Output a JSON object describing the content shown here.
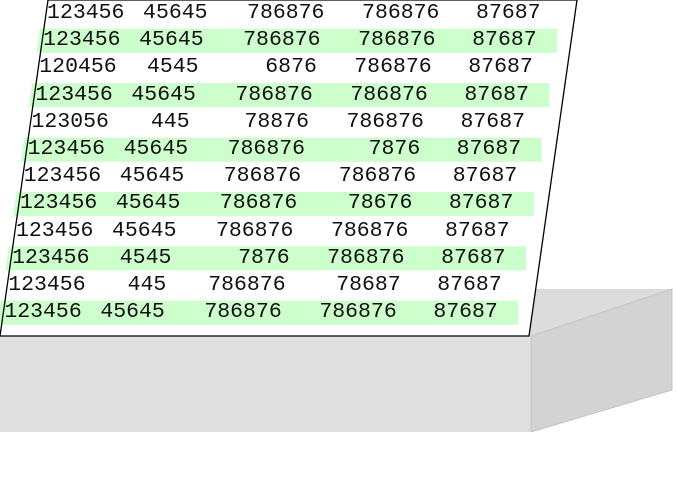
{
  "colors": {
    "stripe": "#ccffcc",
    "text": "#111111",
    "outline": "#000000",
    "box_top": "#dcdcdc",
    "box_front": "#e0e0e0",
    "box_side": "#d3d3d3"
  },
  "sheet": {
    "rows": [
      {
        "striped": false,
        "cells": [
          "123456",
          "45645",
          "786876",
          "786876",
          "87687"
        ]
      },
      {
        "striped": true,
        "cells": [
          "123456",
          "45645",
          "786876",
          "786876",
          "87687"
        ]
      },
      {
        "striped": false,
        "cells": [
          "120456",
          "4545",
          "6876",
          "786876",
          "87687"
        ]
      },
      {
        "striped": true,
        "cells": [
          "123456",
          "45645",
          "786876",
          "786876",
          "87687"
        ]
      },
      {
        "striped": false,
        "cells": [
          "123056",
          "445",
          "78876",
          "786876",
          "87687"
        ]
      },
      {
        "striped": true,
        "cells": [
          "123456",
          "45645",
          "786876",
          "7876",
          "87687"
        ]
      },
      {
        "striped": false,
        "cells": [
          "123456",
          "45645",
          "786876",
          "786876",
          "87687"
        ]
      },
      {
        "striped": true,
        "cells": [
          "123456",
          "45645",
          "786876",
          "78676",
          "87687"
        ]
      },
      {
        "striped": false,
        "cells": [
          "123456",
          "45645",
          "786876",
          "786876",
          "87687"
        ]
      },
      {
        "striped": true,
        "cells": [
          "123456",
          "4545",
          "7876",
          "786876",
          "87687"
        ]
      },
      {
        "striped": false,
        "cells": [
          "123456",
          "445",
          "786876",
          "78687",
          "87687"
        ]
      },
      {
        "striped": true,
        "cells": [
          "123456",
          "45645",
          "786876",
          "786876",
          "87687"
        ]
      }
    ]
  }
}
